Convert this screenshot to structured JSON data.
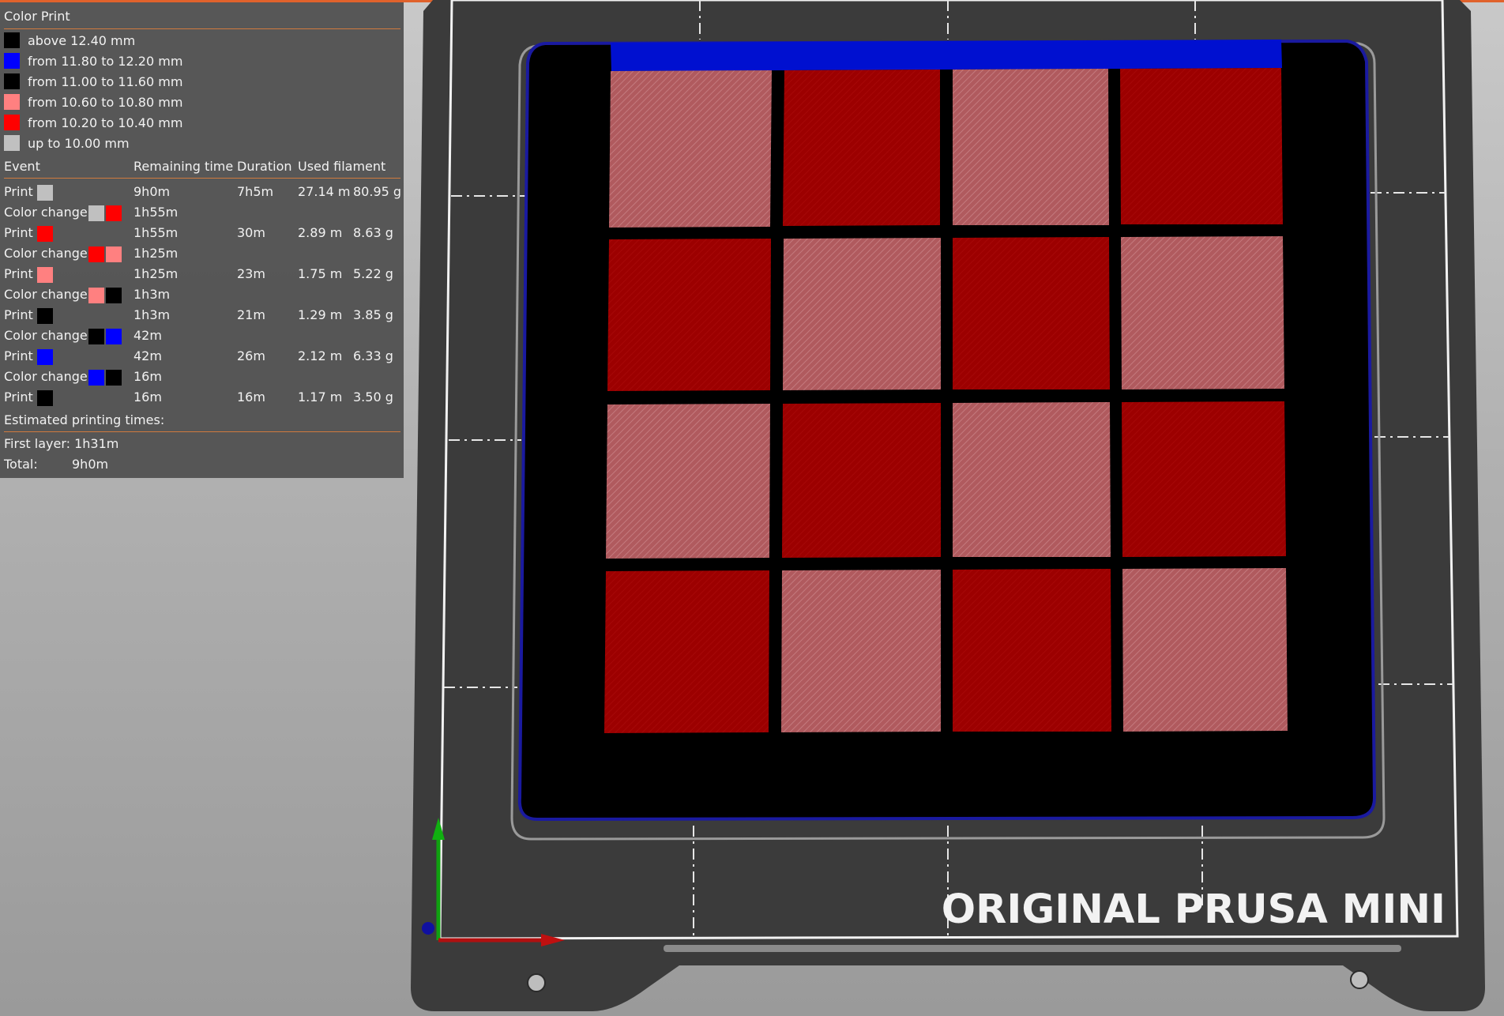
{
  "panel": {
    "title": "Color Print",
    "legend": [
      {
        "label": "above 12.40 mm",
        "color": "#000000"
      },
      {
        "label": "from 11.80 to 12.20 mm",
        "color": "#0000ff"
      },
      {
        "label": "from 11.00 to 11.60 mm",
        "color": "#000000"
      },
      {
        "label": "from 10.60 to 10.80 mm",
        "color": "#ff8080"
      },
      {
        "label": "from 10.20 to 10.40 mm",
        "color": "#ff0000"
      },
      {
        "label": "up to 10.00 mm",
        "color": "#c0c0c0"
      }
    ],
    "headers": {
      "event": "Event",
      "remaining": "Remaining time",
      "duration": "Duration",
      "filament": "Used filament"
    },
    "events": [
      {
        "event": "Print",
        "colors": [
          "#c0c0c0"
        ],
        "remaining": "9h0m",
        "duration": "7h5m",
        "meters": "27.14 m",
        "grams": "80.95 g"
      },
      {
        "event": "Color change",
        "colors": [
          "#c0c0c0",
          "#ff0000"
        ],
        "remaining": "1h55m",
        "duration": "",
        "meters": "",
        "grams": ""
      },
      {
        "event": "Print",
        "colors": [
          "#ff0000"
        ],
        "remaining": "1h55m",
        "duration": "30m",
        "meters": "2.89 m",
        "grams": "8.63 g"
      },
      {
        "event": "Color change",
        "colors": [
          "#ff0000",
          "#ff8080"
        ],
        "remaining": "1h25m",
        "duration": "",
        "meters": "",
        "grams": ""
      },
      {
        "event": "Print",
        "colors": [
          "#ff8080"
        ],
        "remaining": "1h25m",
        "duration": "23m",
        "meters": "1.75 m",
        "grams": "5.22 g"
      },
      {
        "event": "Color change",
        "colors": [
          "#ff8080",
          "#000000"
        ],
        "remaining": "1h3m",
        "duration": "",
        "meters": "",
        "grams": ""
      },
      {
        "event": "Print",
        "colors": [
          "#000000"
        ],
        "remaining": "1h3m",
        "duration": "21m",
        "meters": "1.29 m",
        "grams": "3.85 g"
      },
      {
        "event": "Color change",
        "colors": [
          "#000000",
          "#0000ff"
        ],
        "remaining": "42m",
        "duration": "",
        "meters": "",
        "grams": ""
      },
      {
        "event": "Print",
        "colors": [
          "#0000ff"
        ],
        "remaining": "42m",
        "duration": "26m",
        "meters": "2.12 m",
        "grams": "6.33 g"
      },
      {
        "event": "Color change",
        "colors": [
          "#0000ff",
          "#000000"
        ],
        "remaining": "16m",
        "duration": "",
        "meters": "",
        "grams": ""
      },
      {
        "event": "Print",
        "colors": [
          "#000000"
        ],
        "remaining": "16m",
        "duration": "16m",
        "meters": "1.17 m",
        "grams": "3.50 g"
      }
    ],
    "estimated_title": "Estimated printing times:",
    "first_layer": "First layer: 1h31m",
    "total_label": "Total:",
    "total_value": "9h0m"
  },
  "bed": {
    "brand_label": "ORIGINAL PRUSA MINI"
  },
  "colors": {
    "accent": "#e0622c",
    "panel_rule": "#d07a3e",
    "tile_red": "#9e0000",
    "tile_pink": "#b05a5e",
    "base_black": "#000000",
    "top_blue": "#0010d0",
    "bed": "#3a3a3a"
  }
}
